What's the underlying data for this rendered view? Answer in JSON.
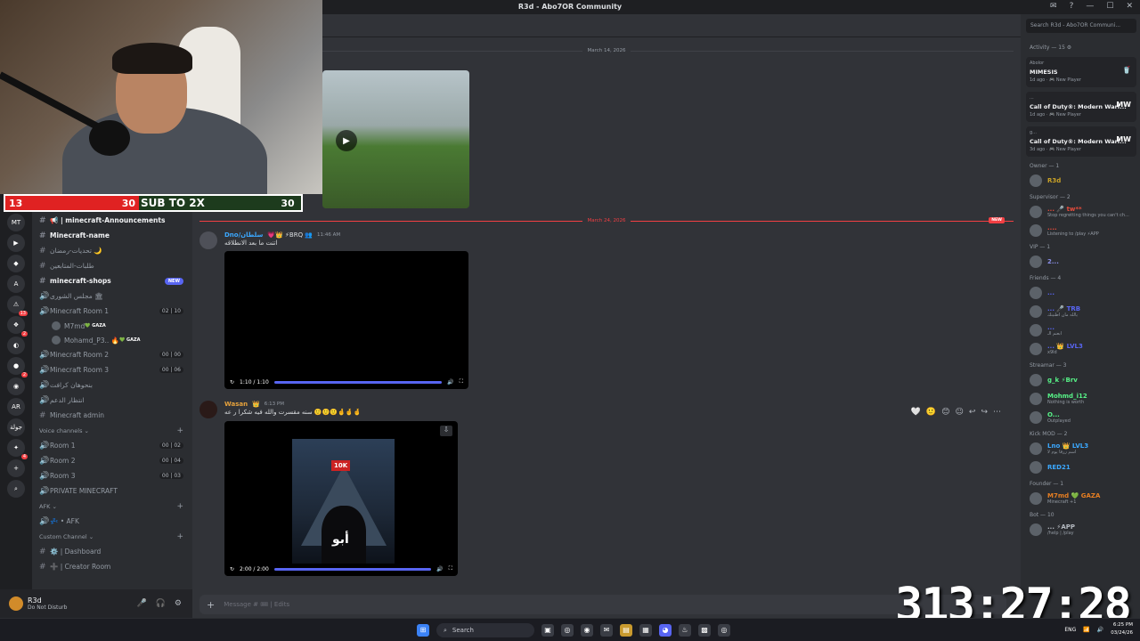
{
  "window": {
    "title": "R3d - Abo7OR Community"
  },
  "search": {
    "placeholder": "Search R3d - Abo7OR Communi..."
  },
  "stream_overlay": {
    "sub_left": "13",
    "sub_mid_num": "30",
    "sub_text": "SUB TO 2X",
    "sub_right": "30",
    "timer": "313:27:28"
  },
  "servers": [
    {
      "label": "MT",
      "badge": ""
    },
    {
      "label": "▶",
      "badge": ""
    },
    {
      "label": "◆",
      "badge": ""
    },
    {
      "label": "A",
      "badge": ""
    },
    {
      "label": "⚠",
      "badge": "13"
    },
    {
      "label": "❖",
      "badge": "2"
    },
    {
      "label": "◐",
      "badge": ""
    },
    {
      "label": "●",
      "badge": "2"
    },
    {
      "label": "◉",
      "badge": ""
    },
    {
      "label": "AR",
      "badge": ""
    },
    {
      "label": "جولة",
      "badge": ""
    },
    {
      "label": "✦",
      "badge": "4"
    },
    {
      "label": "+",
      "badge": ""
    },
    {
      "label": "⌕",
      "badge": ""
    }
  ],
  "channels": {
    "items": [
      {
        "glyph": "#",
        "label": "📢 | minecraft-Announcements",
        "active": true
      },
      {
        "glyph": "#",
        "label": "Minecraft-name",
        "active": true
      },
      {
        "glyph": "#",
        "label": "تحديات-رمضان 🌙",
        "active": false
      },
      {
        "glyph": "#",
        "label": "طلبات-المتابعين",
        "active": false
      },
      {
        "glyph": "#",
        "label": "minecraft-shops",
        "active": true,
        "badge": "NEW"
      },
      {
        "glyph": "🔊",
        "label": "مجلس الشورى 🏛",
        "active": false
      },
      {
        "glyph": "🔊",
        "label": "Minecraft Room 1",
        "active": false,
        "count": "02 | 10"
      }
    ],
    "room_users": [
      {
        "name": "M7md",
        "tag": "💚 GAZA"
      },
      {
        "name": "Mohamd_P3.. 🔥",
        "tag": "💚 GAZA"
      }
    ],
    "items2": [
      {
        "glyph": "🔊",
        "label": "Minecraft Room 2",
        "count": "00 | 00"
      },
      {
        "glyph": "🔊",
        "label": "Minecraft Room 3",
        "count": "00 | 06"
      },
      {
        "glyph": "🔊",
        "label": "بنحوهان كرافت",
        "count": ""
      },
      {
        "glyph": "🔊",
        "label": "انتظار الدعم",
        "count": ""
      },
      {
        "glyph": "#",
        "label": "Minecraft admin",
        "count": ""
      }
    ],
    "voice_category": "Voice channels",
    "voice": [
      {
        "label": "Room 1",
        "count": "00 | 02"
      },
      {
        "label": "Room 2",
        "count": "00 | 04"
      },
      {
        "label": "Room 3",
        "count": "00 | 03"
      },
      {
        "label": "PRIVATE MINECRAFT",
        "count": ""
      }
    ],
    "afk_category": "AFK",
    "afk": "💤 • AFK",
    "custom_category": "Custom Channel",
    "custom": [
      {
        "glyph": "#",
        "label": "⚙️ | Dashboard"
      },
      {
        "glyph": "#",
        "label": "➕ | Creator Room"
      }
    ]
  },
  "user": {
    "name": "R3d",
    "status": "Do Not Disturb"
  },
  "messages": {
    "date1": "March 14, 2026",
    "date2": "March 24, 2026",
    "new_tag": "NEW",
    "m1": {
      "name": "Dno/سلطان",
      "badges": "💗👑 ⚡BRQ 👥",
      "time": "11:46 AM",
      "text": "اتنت ما بعد الانطلاقه",
      "video_time": "1:10 / 1:10"
    },
    "m2": {
      "name": "Wasan",
      "badges": "👑",
      "time": "6:13 PM",
      "text": "سنه مقسرت والله فيه شكرا ر عه 🙂🙂🙂🤞🤞🤞",
      "video_time": "2:00 / 2:00",
      "poster_flag": "10K",
      "poster_logo": "أبو"
    }
  },
  "composer": {
    "placeholder": "Message # 🎟 | Edits"
  },
  "members": {
    "activity_header": "Activity — 15 ⚙",
    "activities": [
      {
        "user": "Abolor",
        "title": "MIMESIS",
        "sub": "1d ago · 🎮 New Player",
        "icon": "🥤"
      },
      {
        "user": "...",
        "title": "Call of Duty®: Modern Warf...",
        "sub": "1d ago · 🎮 New Player",
        "icon": "MW"
      },
      {
        "user": "g...",
        "title": "Call of Duty®: Modern Warf...",
        "sub": "3d ago · 🎮 New Player",
        "icon": "MW"
      }
    ],
    "sections": [
      {
        "label": "Owner — 1",
        "members": [
          {
            "name": "R3d",
            "sub": "",
            "color": "#c9a227"
          }
        ]
      },
      {
        "label": "Supervisor — 2",
        "members": [
          {
            "name": "...  🎤 tw**",
            "sub": "Stop regretting things you can't ch...",
            "color": "#e74c3c"
          },
          {
            "name": "....",
            "sub": "Listening to /play  ⚡APP",
            "color": "#e74c3c"
          }
        ]
      },
      {
        "label": "VIP — 1",
        "members": [
          {
            "name": "2...",
            "sub": "",
            "color": "#8a8fe8"
          }
        ]
      },
      {
        "label": "Friends — 4",
        "members": [
          {
            "name": "...",
            "sub": "",
            "color": "#5865f2"
          },
          {
            "name": "...  🎤 TRB",
            "sub": "يالله مان اطنينك",
            "color": "#5865f2"
          },
          {
            "name": "...",
            "sub": "ابعنم الـ",
            "color": "#5865f2"
          },
          {
            "name": "...  👑 LVL3",
            "sub": "x9ld",
            "color": "#5865f2"
          }
        ]
      },
      {
        "label": "Streamar — 3",
        "members": [
          {
            "name": "g_k ⚡Brv",
            "sub": "",
            "color": "#57f287"
          },
          {
            "name": "Mohmd_i12",
            "sub": "Nothing is worth",
            "color": "#57f287"
          },
          {
            "name": "O...",
            "sub": "Outplayed",
            "color": "#57f287"
          }
        ]
      },
      {
        "label": "Kick MOD — 2",
        "members": [
          {
            "name": "Lno 👑 LVL3",
            "sub": "اسم زرقا يوم لا",
            "color": "#3ba8ff"
          },
          {
            "name": "RED21",
            "sub": "",
            "color": "#3ba8ff"
          }
        ]
      },
      {
        "label": "Founder — 1",
        "members": [
          {
            "name": "M7md 💚 GAZA",
            "sub": "Minecraft +1",
            "color": "#e67e22"
          }
        ]
      },
      {
        "label": "Bot — 10",
        "members": [
          {
            "name": "...  ⚡APP",
            "sub": "/help | /play",
            "color": "#b5bac1"
          }
        ]
      }
    ]
  },
  "taskbar": {
    "search": "Search",
    "lang": "ENG",
    "time": "6:25 PM",
    "date": "03/24/26"
  }
}
